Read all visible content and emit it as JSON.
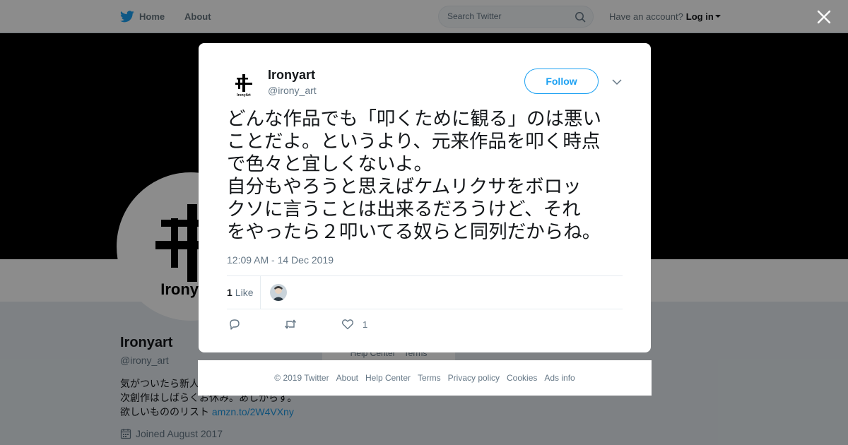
{
  "topbar": {
    "home_label": "Home",
    "about_label": "About",
    "search_placeholder": "Search Twitter",
    "have_account": "Have an account?",
    "login_label": "Log in"
  },
  "profile": {
    "name": "Ironyart",
    "handle": "@irony_art",
    "bio_lines": [
      "気がついたら新人",
      "次創作はしばらくお休み。あしからず。"
    ],
    "wishlist_prefix": "欲しいもののリスト",
    "wishlist_link": "amzn.to/2W4VXny",
    "joined": "Joined August 2017",
    "avatar_text": "IronyArt"
  },
  "background_footer": {
    "help_center": "Help Center",
    "terms": "Terms"
  },
  "tweet": {
    "author_name": "Ironyart",
    "author_handle": "@irony_art",
    "follow_label": "Follow",
    "text_lines": [
      "どんな作品でも「叩くために観る」のは悪い",
      "ことだよ。というより、元来作品を叩く時点",
      "で色々と宜しくないよ。",
      "自分もやろうと思えばケムリクサをボロッ",
      "クソに言うことは出来るだろうけど、それ",
      "をやったら２叩いてる奴らと同列だからね。"
    ],
    "timestamp": "12:09 AM - 14 Dec 2019",
    "like_count": "1",
    "like_label": "Like",
    "action_like_count": "1"
  },
  "modal_footer": {
    "copyright": "© 2019 Twitter",
    "about": "About",
    "help_center": "Help Center",
    "terms": "Terms",
    "privacy": "Privacy policy",
    "cookies": "Cookies",
    "ads_info": "Ads info"
  },
  "colors": {
    "accent": "#1da1f2",
    "link": "#1b95e0",
    "muted": "#657786",
    "banner": "#000000"
  },
  "icons": [
    "twitter-bird-icon",
    "search-icon",
    "close-icon",
    "chevron-down-icon",
    "reply-icon",
    "retweet-icon",
    "heart-icon",
    "calendar-icon"
  ]
}
